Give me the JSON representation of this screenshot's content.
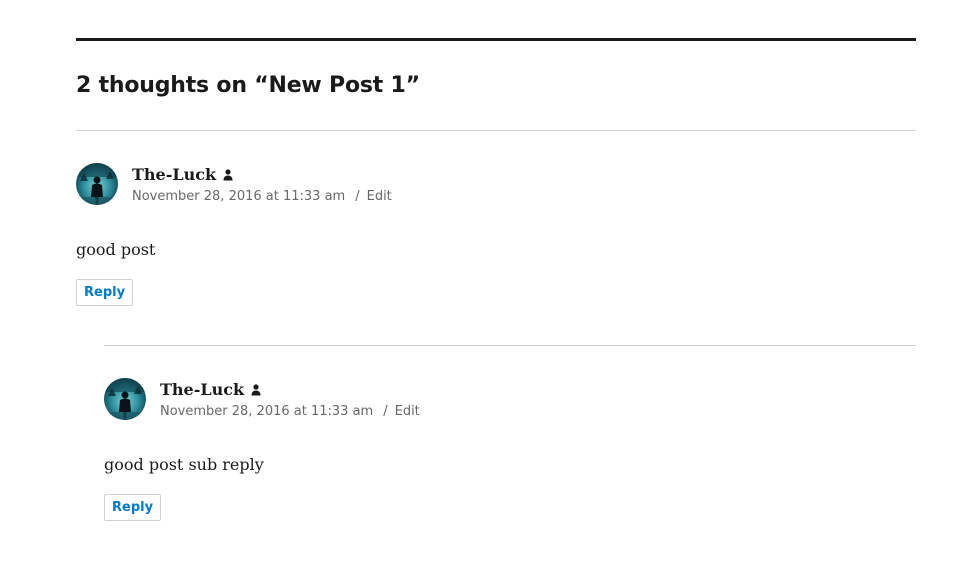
{
  "comments_title": "2 thoughts on “New Post 1”",
  "comments": [
    {
      "author": "The-Luck",
      "author_icon": "user-icon",
      "date": "November 28, 2016 at 11:33 am",
      "separator": "/",
      "edit_label": "Edit",
      "text": "good post",
      "reply_label": "Reply"
    },
    {
      "author": "The-Luck",
      "author_icon": "user-icon",
      "date": "November 28, 2016 at 11:33 am",
      "separator": "/",
      "edit_label": "Edit",
      "text": "good post sub reply",
      "reply_label": "Reply"
    }
  ],
  "colors": {
    "text": "#1a1a1a",
    "meta": "#686868",
    "link": "#007acc",
    "rule": "#d1d1d1"
  }
}
